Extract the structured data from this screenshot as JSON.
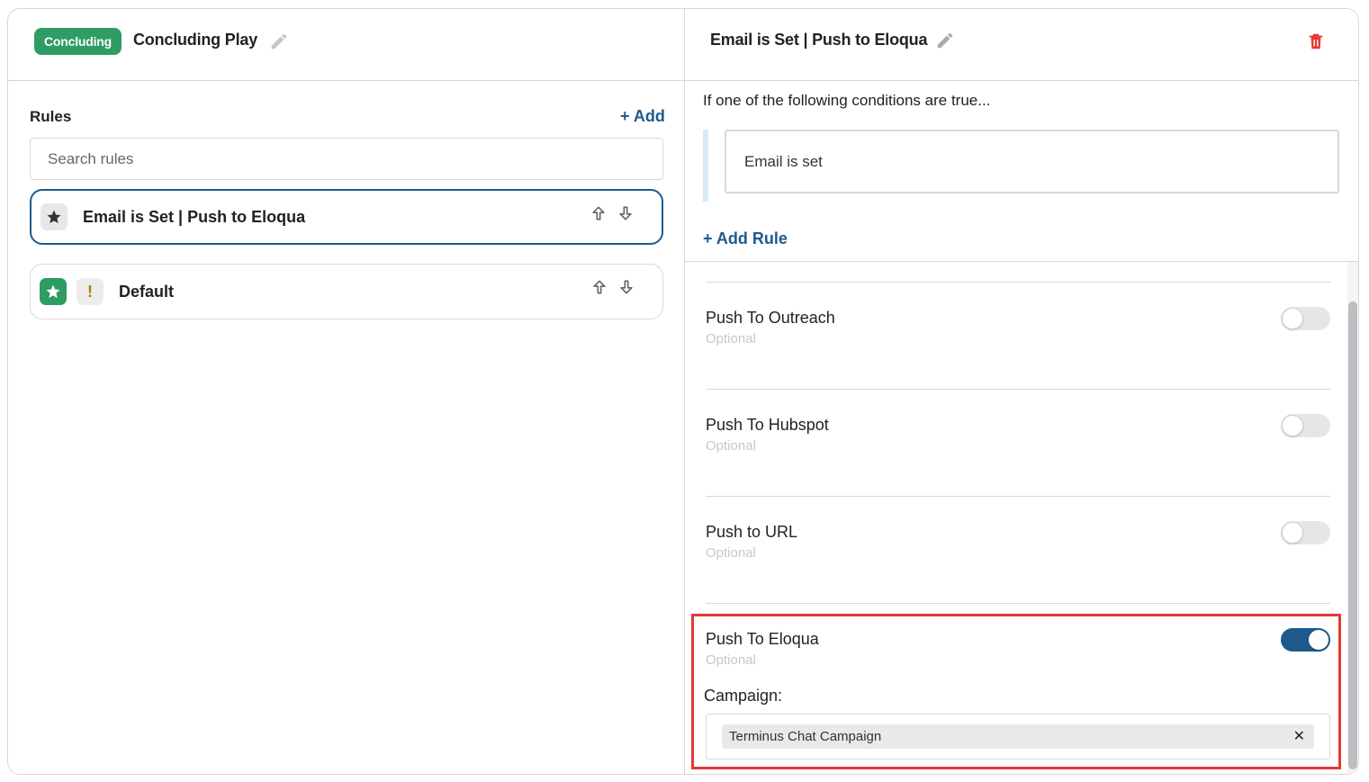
{
  "left_header": {
    "badge": "Concluding",
    "play_title": "Concluding Play",
    "edit_icon": "pencil-icon"
  },
  "rules_panel": {
    "label": "Rules",
    "add_label": "+ Add",
    "search_placeholder": "Search rules",
    "rules": [
      {
        "name": "Email is Set | Push to Eloqua",
        "icon": "star-icon",
        "selected": true
      },
      {
        "name": "Default",
        "icon": "star-icon",
        "warning_icon": "exclamation-icon",
        "selected": false
      }
    ]
  },
  "right_header": {
    "title": "Email is Set | Push to Eloqua",
    "edit_icon": "pencil-icon",
    "delete_icon": "trash-icon"
  },
  "conditions": {
    "heading": "If one of the following conditions are true...",
    "items": [
      "Email is set"
    ],
    "add_rule_label": "+ Add Rule"
  },
  "actions": [
    {
      "name": "Push To Outreach",
      "sub": "Optional",
      "enabled": false
    },
    {
      "name": "Push To Hubspot",
      "sub": "Optional",
      "enabled": false
    },
    {
      "name": "Push to URL",
      "sub": "Optional",
      "enabled": false
    },
    {
      "name": "Push To Eloqua",
      "sub": "Optional",
      "enabled": true
    }
  ],
  "campaign": {
    "label": "Campaign:",
    "value": "Terminus Chat Campaign",
    "clear_icon": "close-icon"
  },
  "colors": {
    "accent": "#1e5a8c",
    "badge_green": "#2e9d63",
    "delete_red": "#e53935",
    "highlight_red": "#e53935"
  }
}
